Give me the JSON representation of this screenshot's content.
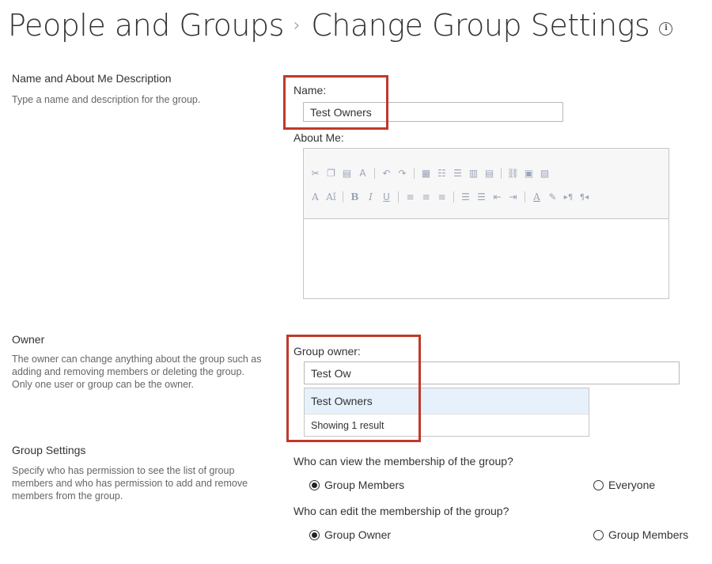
{
  "title": {
    "parent": "People and Groups",
    "current": "Change Group Settings"
  },
  "sections": {
    "name_about": {
      "title": "Name and About Me Description",
      "description": "Type a name and description for the group.",
      "name_label": "Name:",
      "name_value": "Test Owners",
      "about_label": "About Me:"
    },
    "owner": {
      "title": "Owner",
      "description": "The owner can change anything about the group such as adding and removing members or deleting the group. Only one user or group can be the owner.",
      "label": "Group owner:",
      "value": "Test Ow",
      "suggestion": "Test Owners",
      "suggestion_count": "Showing 1 result"
    },
    "group_settings": {
      "title": "Group Settings",
      "description": "Specify who has permission to see the list of group members and who has permission to add and remove members from the group.",
      "view_question": "Who can view the membership of the group?",
      "view_options": [
        "Group Members",
        "Everyone"
      ],
      "view_selected": "Group Members",
      "edit_question": "Who can edit the membership of the group?",
      "edit_options": [
        "Group Owner",
        "Group Members"
      ],
      "edit_selected": "Group Owner"
    }
  },
  "toolbar": {
    "row1": [
      "cut-icon",
      "copy-icon",
      "paste-icon",
      "spellcheck-icon",
      "|",
      "undo-icon",
      "redo-icon",
      "|",
      "table-icon",
      "bullets-style-icon",
      "numbering-style-icon",
      "insert-row-icon",
      "insert-column-icon",
      "|",
      "link-icon",
      "image-icon",
      "embed-icon"
    ],
    "row2": [
      "font-color-a-icon",
      "font-size-icon",
      "|",
      "bold-icon",
      "italic-icon",
      "underline-icon",
      "|",
      "align-left-icon",
      "align-center-icon",
      "align-right-icon",
      "|",
      "numbered-list-icon",
      "bulleted-list-icon",
      "decrease-indent-icon",
      "increase-indent-icon",
      "|",
      "text-color-icon",
      "highlight-icon",
      "ltr-icon",
      "rtl-icon"
    ]
  },
  "colors": {
    "highlight_border": "#c0392b",
    "suggestion_bg": "#e6f1fb"
  }
}
